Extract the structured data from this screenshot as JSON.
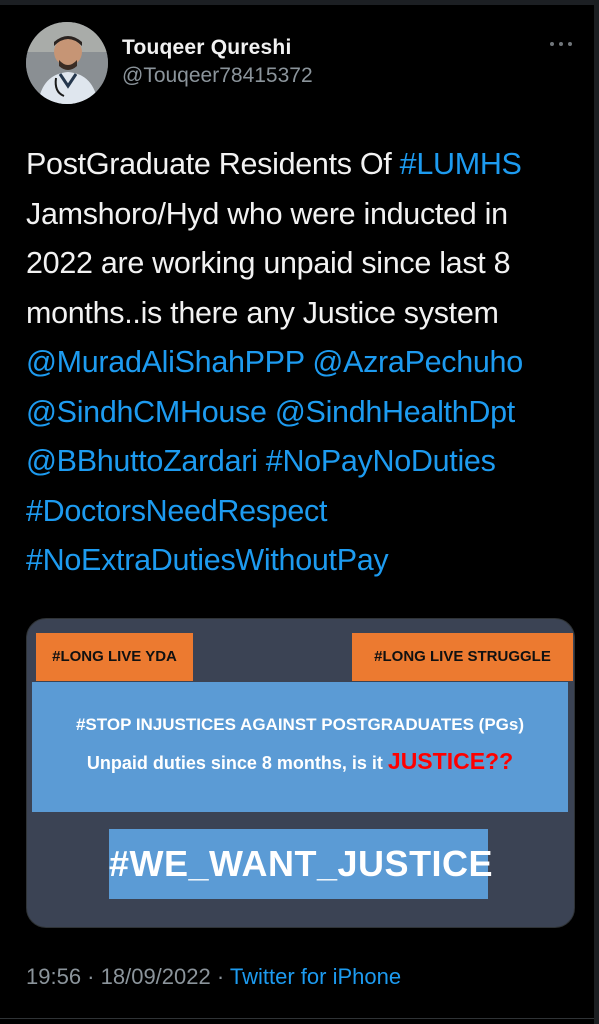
{
  "tweet": {
    "display_name": "Touqeer Qureshi",
    "handle": "@Touqeer78415372",
    "text": {
      "line1_prefix": "PostGraduate Residents Of ",
      "hashtag_lumhs": "#LUMHS",
      "line2": "Jamshoro/Hyd who were inducted in",
      "line3": "2022 are working unpaid since last 8",
      "line4": "months..is there any Justice system",
      "mention1": "@MuradAliShahPPP",
      "mention2": "@AzraPechuho",
      "mention3": "@SindhCMHouse",
      "mention4": "@SindhHealthDpt",
      "mention5": "@BBhuttoZardari",
      "hashtag1": "#NoPayNoDuties",
      "hashtag2": "#DoctorsNeedRespect",
      "hashtag3": "#NoExtraDutiesWithoutPay"
    },
    "media": {
      "tag_left": "#LONG LIVE YDA",
      "tag_right": "#LONG LIVE STRUGGLE",
      "panel_line1": "#STOP INJUSTICES AGAINST POSTGRADUATES (PGs)",
      "panel_line2": "Unpaid duties since 8 months, is it ",
      "panel_red": "JUSTICE??",
      "justice_box": "#WE_WANT_JUSTICE"
    },
    "time": "19:56",
    "separator": " · ",
    "date": "18/09/2022",
    "source": "Twitter for iPhone"
  },
  "icons": {
    "more": "more-horizontal-icon"
  },
  "colors": {
    "background": "#000000",
    "link": "#1d9bf0",
    "orange_tag": "#ec7a30",
    "blue_panel": "#5b9bd5",
    "justice_red": "#ff0000"
  }
}
